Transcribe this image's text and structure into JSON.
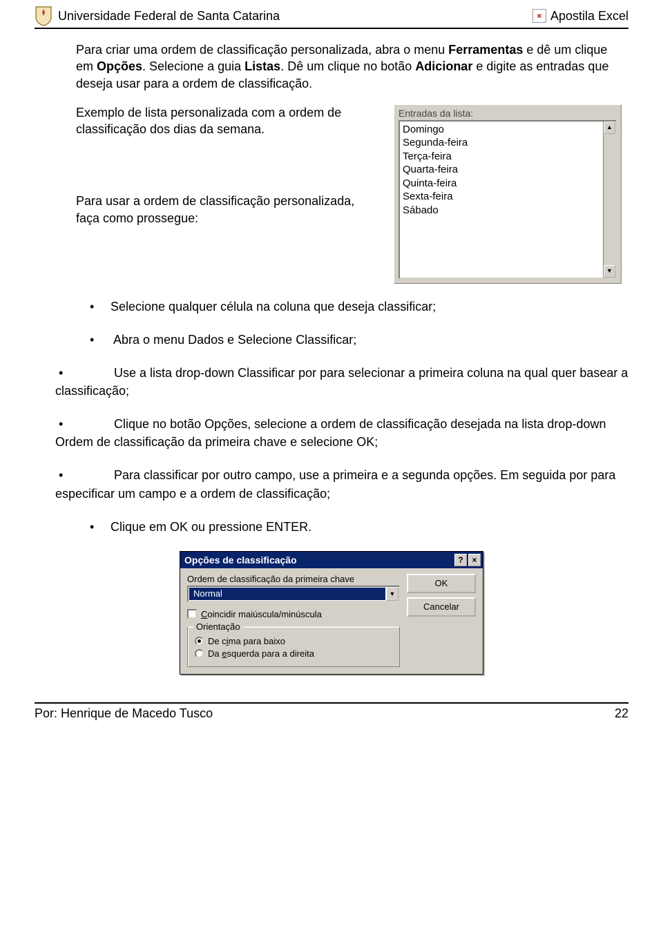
{
  "header": {
    "left": "Universidade Federal de Santa Catarina",
    "right": "Apostila Excel"
  },
  "para1_parts": [
    "Para criar uma ordem de classificação personalizada, abra o menu ",
    "Ferramentas",
    " e dê um clique em ",
    "Opções",
    ". Selecione a guia ",
    "Listas",
    ". Dê um clique no botão ",
    "Adicionar",
    " e digite as entradas que deseja usar para a ordem de classificação."
  ],
  "caption1": "Exemplo de lista personalizada com a ordem de classificação dos dias da semana.",
  "caption2": "Para usar a ordem de classificação personalizada, faça como prossegue:",
  "listbox": {
    "label": "Entradas da lista:",
    "items": [
      "Domingo",
      "Segunda-feira",
      "Terça-feira",
      "Quarta-feira",
      "Quinta-feira",
      "Sexta-feira",
      "Sábado"
    ]
  },
  "bullets": [
    {
      "text": "Selecione qualquer célula na coluna que deseja classificar;"
    },
    {
      "pre": "Abra o menu ",
      "b1": "Dados",
      "mid": " e Selecione ",
      "b2": "Classificar",
      ";": ";"
    },
    {
      "pre": "Use a lista drop-down ",
      "b1": "Classificar por",
      "post": " para selecionar a primeira coluna na qual quer basear a classificação;"
    },
    {
      "pre": "Clique no botão ",
      "b1": "Opções",
      "mid": ", selecione a ordem de classificação desejada na lista drop-down ",
      "b2": "Ordem de classificação",
      "post": " da primeira chave e selecione OK;"
    },
    {
      "text": "Para classificar por outro campo, use a primeira e a segunda opções. Em seguida por para especificar um campo e a ordem de classificação;"
    },
    {
      "text": "Clique em OK ou pressione ENTER."
    }
  ],
  "dialog": {
    "title": "Opções de classificação",
    "help": "?",
    "close": "×",
    "label1": "Ordem de classificação da primeira chave",
    "combo_value": "Normal",
    "chk_label_pre": "C",
    "chk_label_rest": "oincidir maiúscula/minúscula",
    "fieldset_legend": "Orientação",
    "radio1_pre": "De c",
    "radio1_u": "i",
    "radio1_post": "ma para baixo",
    "radio2_pre": "Da ",
    "radio2_u": "e",
    "radio2_post": "squerda para a direita",
    "ok": "OK",
    "cancel": "Cancelar"
  },
  "footer": {
    "author": "Por: Henrique de Macedo Tusco",
    "page": "22"
  }
}
